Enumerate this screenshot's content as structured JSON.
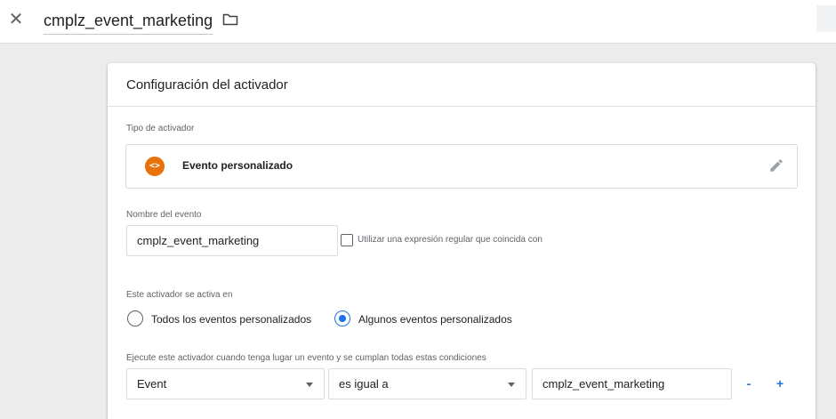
{
  "header": {
    "title": "cmplz_event_marketing",
    "close_icon": "close-icon",
    "folder_icon": "folder-icon"
  },
  "card": {
    "title": "Configuración del activador",
    "trigger_type": {
      "label": "Tipo de activador",
      "name": "Evento personalizado",
      "icon_glyph": "<>",
      "icon_color": "#e8710a"
    },
    "event_name": {
      "label": "Nombre del evento",
      "value": "cmplz_event_marketing",
      "regex_label": "Utilizar una expresión regular que coincida con",
      "regex_checked": false
    },
    "fires_on": {
      "label": "Este activador se activa en",
      "options": [
        {
          "label": "Todos los eventos personalizados",
          "selected": false
        },
        {
          "label": "Algunos eventos personalizados",
          "selected": true
        }
      ]
    },
    "conditions": {
      "label": "Ejecute este activador cuando tenga lugar un evento y se cumplan todas estas condiciones",
      "variable": "Event",
      "operator": "es igual a",
      "value": "cmplz_event_marketing",
      "remove_label": "-",
      "add_label": "+"
    }
  },
  "colors": {
    "accent": "#1a73e8",
    "trigger_icon": "#e8710a",
    "background": "#ececec"
  }
}
